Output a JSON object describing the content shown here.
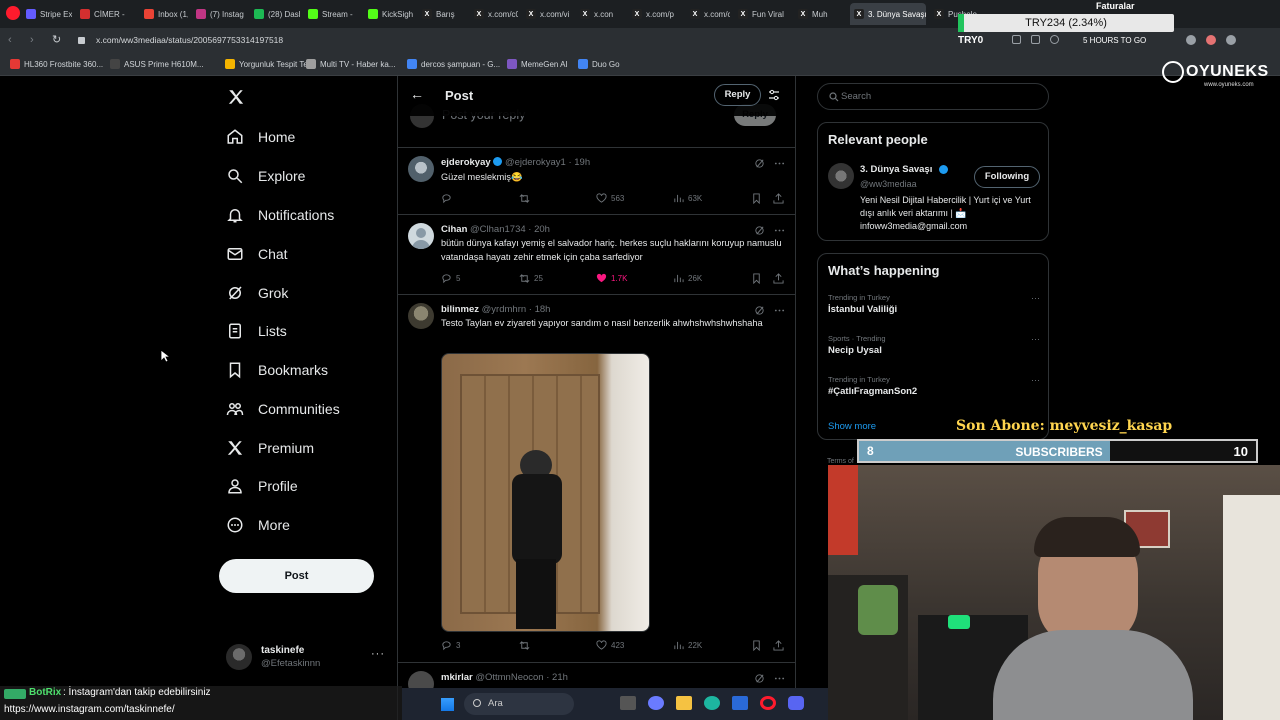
{
  "browser": {
    "tabs": [
      {
        "label": "Stripe Ex",
        "color": "#635bff"
      },
      {
        "label": "CİMER -",
        "color": "#d32f2f"
      },
      {
        "label": "Inbox (1,",
        "color": "#ea4335"
      },
      {
        "label": "(7) Instag",
        "color": "#c13584"
      },
      {
        "label": "(28) Dash",
        "color": "#1db954"
      },
      {
        "label": "Stream -",
        "color": "#53fc18"
      },
      {
        "label": "KickSigh",
        "color": "#53fc18"
      },
      {
        "label": "Barış",
        "color": "#222"
      },
      {
        "label": "x.com/c0",
        "color": "#222"
      },
      {
        "label": "x.com/vi",
        "color": "#222"
      },
      {
        "label": "x.con",
        "color": "#222"
      },
      {
        "label": "x.com/p",
        "color": "#222"
      },
      {
        "label": "x.com/cl",
        "color": "#222"
      },
      {
        "label": "Fun Viral",
        "color": "#222"
      },
      {
        "label": "Muh",
        "color": "#222"
      },
      {
        "label": "3. Dünya Savaşı",
        "color": "#222"
      },
      {
        "label": "Pusholo",
        "color": "#222"
      }
    ],
    "url": "x.com/ww3mediaa/status/2005697753314197518",
    "ticker": "TRY234 (2.34%)",
    "ticker_left": "TRY0",
    "hours": "5 HOURS TO GO",
    "faturalar": "Faturalar",
    "bookmarks": [
      {
        "label": "HL360 Frostbite 360...",
        "color": "#e53935"
      },
      {
        "label": "ASUS Prime H610M...",
        "color": "#444"
      },
      {
        "label": "Yorgunluk Tespit Test",
        "color": "#f4b400"
      },
      {
        "label": "Multi TV - Haber ka...",
        "color": "#9e9e9e"
      },
      {
        "label": "dercos şampuan - G...",
        "color": "#4285f4"
      },
      {
        "label": "MemeGen AI",
        "color": "#7e57c2"
      },
      {
        "label": "Duo Go",
        "color": "#4285f4"
      }
    ]
  },
  "nav": {
    "items": [
      "Home",
      "Explore",
      "Notifications",
      "Chat",
      "Grok",
      "Lists",
      "Bookmarks",
      "Communities",
      "Premium",
      "Profile",
      "More"
    ],
    "post_label": "Post",
    "account_name": "taskinefe",
    "account_handle": "@Efetaskinnn"
  },
  "header": {
    "title": "Post",
    "reply_label": "Reply",
    "composer_placeholder": "Post your reply",
    "composer_reply": "Reply"
  },
  "tweets": [
    {
      "name": "ejderokyay",
      "handle": "@ejderokyay1",
      "time": "· 19h",
      "text": "Güzel meslekmiş😂",
      "replies": "",
      "reposts": "",
      "likes": "563",
      "views": "63K"
    },
    {
      "name": "Cihan",
      "handle": "@Clhan1734",
      "time": "· 20h",
      "text": "bütün dünya kafayı yemiş el salvador hariç. herkes suçlu haklarını koruyup namuslu vatandaşa hayatı zehir etmek için çaba sarfediyor",
      "replies": "5",
      "reposts": "25",
      "likes": "1.7K",
      "views": "26K"
    },
    {
      "name": "bilinmez",
      "handle": "@yrdmhrn",
      "time": "· 18h",
      "text": "Testo Taylan ev ziyareti yapıyor sandım o nasıl benzerlik ahwhshwhshwhshaha",
      "replies": "3",
      "reposts": "",
      "likes": "423",
      "views": "22K"
    },
    {
      "name": "mkirlar",
      "handle": "@OttmnNeocon",
      "time": "· 21h",
      "text": "",
      "replies": "",
      "reposts": "",
      "likes": "",
      "views": ""
    }
  ],
  "search": {
    "placeholder": "Search"
  },
  "relevant": {
    "title": "Relevant people",
    "name": "3. Dünya Savaşı",
    "handle": "@ww3mediaa",
    "follow_label": "Following",
    "bio": "Yeni Nesil Dijital Habercilik | Yurt içi ve Yurt dışı anlık veri aktarımı | 📩 infoww3media@gmail.com"
  },
  "happening": {
    "title": "What’s happening",
    "trends": [
      {
        "sub": "Trending in Turkey",
        "name": "İstanbul Valiliği"
      },
      {
        "sub": "Sports · Trending",
        "name": "Necip Uysal"
      },
      {
        "sub": "Trending in Turkey",
        "name": "#ÇatlıFragmanSon2"
      }
    ],
    "show_more": "Show more",
    "terms": "Terms of"
  },
  "overlay": {
    "logo": "OYUNEKS",
    "logo_sub": "www.oyuneks.com",
    "last_sub_label": "Son Abone: meyvesiz_kasap",
    "sub_current": "8",
    "sub_label": "SUBSCRIBERS",
    "sub_goal": "10",
    "sub_progress": 0.8,
    "botrix": "BotRix",
    "chat_msg": ": İnstagram'dan takip edebilirsiniz",
    "chat_link": "https://www.instagram.com/taskinnefe/"
  },
  "taskbar": {
    "search_placeholder": "Ara"
  }
}
